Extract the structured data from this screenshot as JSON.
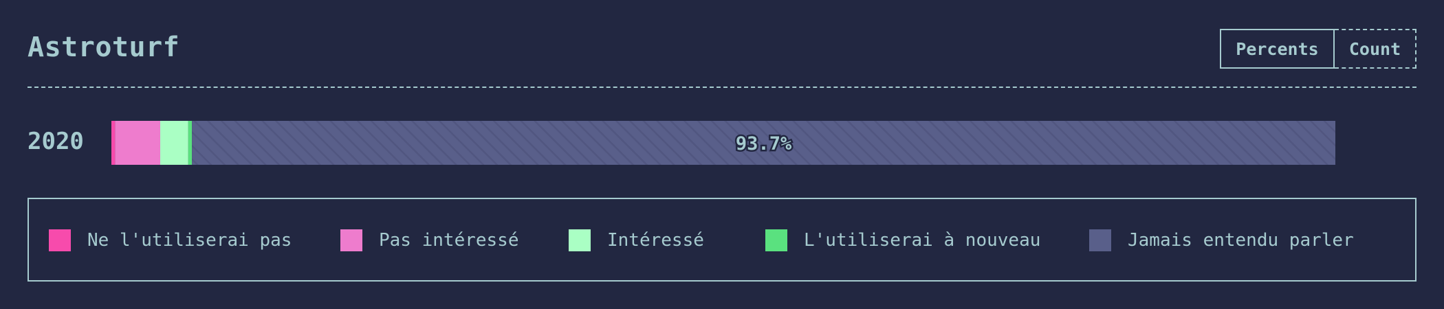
{
  "header": {
    "title": "Astroturf",
    "toggle": {
      "percents_label": "Percents",
      "count_label": "Count",
      "selected": "Percents"
    }
  },
  "colors": {
    "background": "#222741",
    "text": "#a6cbcf",
    "would_not_use": "#f74bac",
    "not_interested": "#ee7ccd",
    "interested": "#aaffc4",
    "would_use_again": "#5ae17f",
    "never_heard": "#595f8a"
  },
  "chart_data": {
    "type": "bar",
    "orientation": "horizontal",
    "stacked": true,
    "normalized": true,
    "categories": [
      "2020"
    ],
    "series": [
      {
        "name": "Ne l'utiliserai pas",
        "color": "#f74bac",
        "values": [
          0.3
        ]
      },
      {
        "name": "Pas intéressé",
        "color": "#ee7ccd",
        "values": [
          3.7
        ]
      },
      {
        "name": "Intéressé",
        "color": "#aaffc4",
        "values": [
          2.3
        ]
      },
      {
        "name": "L'utiliserai à nouveau",
        "color": "#5ae17f",
        "values": [
          0.3
        ]
      },
      {
        "name": "Jamais entendu parler",
        "color": "#595f8a",
        "values": [
          93.7
        ]
      }
    ],
    "data_labels": [
      {
        "category": "2020",
        "series": "Jamais entendu parler",
        "text": "93.7%"
      }
    ],
    "legend_position": "bottom"
  }
}
